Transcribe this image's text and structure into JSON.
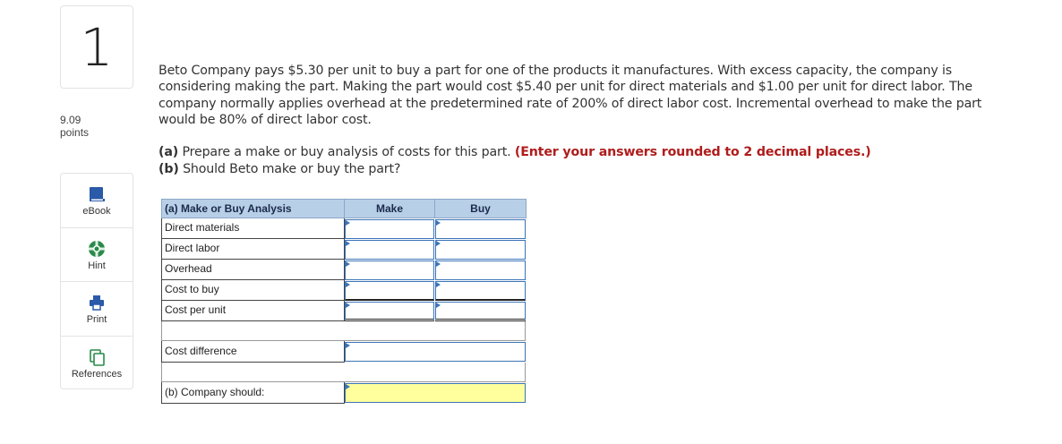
{
  "question": {
    "number": "1",
    "points_value": "9.09",
    "points_label": "points",
    "body": "Beto Company pays $5.30 per unit to buy a part for one of the products it manufactures. With excess capacity, the company is considering making the part. Making the part would cost $5.40 per unit for direct materials and $1.00 per unit for direct labor. The company normally applies overhead at the predetermined rate of 200% of direct labor cost. Incremental overhead to make the part would be 80% of direct labor cost.",
    "part_a_prefix": "(a)",
    "part_a_text": "Prepare a make or buy analysis of costs for this part.",
    "part_a_instruction": "(Enter your answers rounded to 2 decimal places.)",
    "part_b_prefix": "(b)",
    "part_b_text": "Should Beto make or buy the part?"
  },
  "tools": [
    {
      "label": "eBook",
      "icon": "ebook-icon"
    },
    {
      "label": "Hint",
      "icon": "hint-icon"
    },
    {
      "label": "Print",
      "icon": "print-icon"
    },
    {
      "label": "References",
      "icon": "references-icon"
    }
  ],
  "table": {
    "title": "(a) Make or Buy Analysis",
    "col_make": "Make",
    "col_buy": "Buy",
    "rows": [
      "Direct materials",
      "Direct labor",
      "Overhead",
      "Cost to buy",
      "Cost per unit"
    ],
    "cost_difference": "Cost difference",
    "company_should": "(b) Company should:"
  },
  "colors": {
    "header_bg": "#b8cfe8",
    "input_border": "#3b74b8",
    "select_bg": "#ffff9e",
    "instruction_red": "#b01c1c"
  }
}
